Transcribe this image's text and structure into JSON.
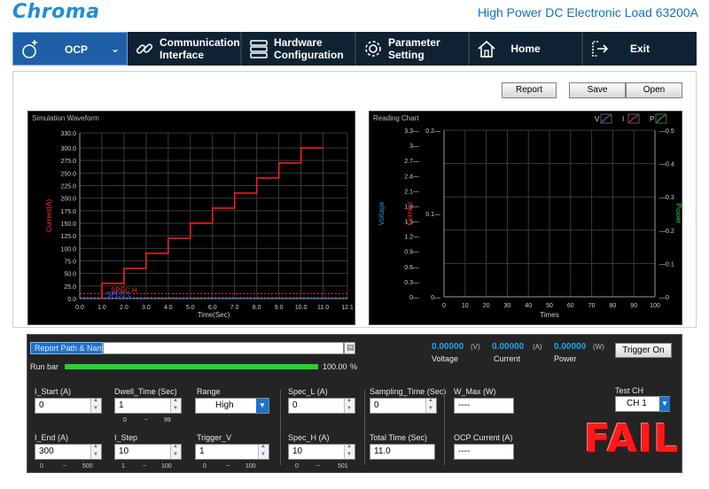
{
  "header": {
    "logo": "Chroma",
    "title": "High Power DC Electronic Load 63200A"
  },
  "nav": {
    "mode": "OCP",
    "items": [
      {
        "line1": "Communication",
        "line2": "Interface"
      },
      {
        "line1": "Hardware",
        "line2": "Configuration"
      },
      {
        "line1": "Parameter",
        "line2": "Setting"
      },
      {
        "label": "Home"
      },
      {
        "label": "Exit"
      }
    ]
  },
  "toolbar": {
    "report": "Report",
    "save": "Save",
    "open": "Open"
  },
  "sim": {
    "title": "Simulation Waveform",
    "ylabel": "Current(A)",
    "xlabel": "Time(Sec)",
    "spec_h": "SPEC H",
    "spec_l": "SPEC L",
    "yticks": [
      "330.0",
      "300.0",
      "275.0",
      "250.0",
      "225.0",
      "200.0",
      "175.0",
      "150.0",
      "125.0",
      "100.0",
      "75.0",
      "50.0",
      "25.0",
      "0.0"
    ],
    "xticks": [
      "0.0",
      "1.0",
      "2.0",
      "3.0",
      "4.0",
      "5.0",
      "6.0",
      "7.0",
      "8.0",
      "9.0",
      "10.0",
      "11.0",
      "12.1"
    ]
  },
  "reading": {
    "title": "Reading Chart",
    "legend": {
      "v": "V",
      "i": "I",
      "p": "P"
    },
    "xlabel": "Times",
    "vlabel": "Voltage",
    "ilabel": "Current",
    "plabel": "Power",
    "vticks": [
      "3.3",
      "3",
      "2.7",
      "2.4",
      "2.1",
      "1.8",
      "1.5",
      "1.2",
      "0.9",
      "0.6",
      "0.3",
      "0"
    ],
    "iticks": [
      "0.2",
      "0.1",
      "0"
    ],
    "pticks": [
      "0.5",
      "0.4",
      "0.3",
      "0.2",
      "0.1",
      "0"
    ],
    "xticks": [
      "0",
      "10",
      "20",
      "30",
      "40",
      "50",
      "60",
      "70",
      "80",
      "90",
      "100"
    ]
  },
  "chart_data": [
    {
      "type": "line",
      "title": "Simulation Waveform",
      "xlabel": "Time(Sec)",
      "ylabel": "Current(A)",
      "xlim": [
        0,
        12.1
      ],
      "ylim": [
        0,
        330
      ],
      "series": [
        {
          "x": [
            0.9,
            1.0,
            1.0,
            2.0,
            2.0,
            3.0,
            3.0,
            4.0,
            4.0,
            5.0,
            5.0,
            6.0,
            6.0,
            7.0,
            7.0,
            8.0,
            8.0,
            9.0,
            9.0,
            10.0,
            10.0,
            11.0
          ],
          "y": [
            0,
            0,
            30,
            30,
            60,
            60,
            90,
            90,
            120,
            120,
            150,
            150,
            180,
            180,
            210,
            210,
            240,
            240,
            270,
            270,
            300,
            300
          ],
          "color": "#ff2020"
        }
      ],
      "spec_h": 10,
      "spec_l": 0,
      "grid": true
    },
    {
      "type": "line",
      "title": "Reading Chart",
      "xlabel": "Times",
      "xlim": [
        0,
        100
      ],
      "ylim_voltage": [
        0,
        3.3
      ],
      "ylim_current": [
        0,
        0.2
      ],
      "ylim_power": [
        0,
        0.5
      ],
      "series": [],
      "grid": true
    }
  ],
  "bottom": {
    "report_path_label": "Report Path & Name",
    "report_path_value": "",
    "runbar_label": "Run bar",
    "runbar_value": "100.00",
    "runbar_unit": "%",
    "runbar_progress": 1.0,
    "voltage_value": "0.00000",
    "voltage_unit": "(V)",
    "voltage_label": "Voltage",
    "current_value": "0.00000",
    "current_unit": "(A)",
    "current_label": "Current",
    "power_value": "0.00000",
    "power_unit": "(W)",
    "power_label": "Power",
    "trigger_button": "Trigger On",
    "i_start_label": "I_Start (A)",
    "i_start_value": "0",
    "i_end_label": "I_End (A)",
    "i_end_value": "300",
    "i_end_min": "0",
    "i_end_max": "500",
    "dwell_label": "Dwell_Time (Sec)",
    "dwell_value": "1",
    "dwell_min": "0",
    "dwell_max": "99",
    "i_step_label": "I_Step",
    "i_step_value": "10",
    "i_step_min": "1",
    "i_step_max": "100",
    "range_label": "Range",
    "range_value": "High",
    "trigger_v_label": "Trigger_V",
    "trigger_v_value": "1",
    "trigger_v_min": "0",
    "trigger_v_max": "100",
    "spec_l_label": "Spec_L (A)",
    "spec_l_value": "0",
    "spec_h_label": "Spec_H (A)",
    "spec_h_value": "10",
    "spec_h_min": "0",
    "spec_h_max": "501",
    "sampling_label": "Sampling_Time (Sec)",
    "sampling_value": "0",
    "total_time_label": "Total Time (Sec)",
    "total_time_value": "11.0",
    "w_max_label": "W_Max (W)",
    "w_max_value": "----",
    "ocp_current_label": "OCP Current (A)",
    "ocp_current_value": "----",
    "test_ch_label": "Test  CH",
    "test_ch_value": "CH 1",
    "tilde": "~",
    "result": "FAIL"
  },
  "colors": {
    "accent": "#1e5fa8",
    "fail": "#ff1a1a",
    "runbar": "#27d132",
    "readout": "#1fa3e8"
  }
}
